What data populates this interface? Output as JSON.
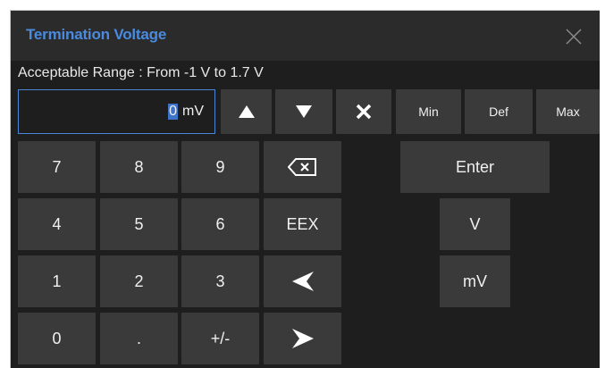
{
  "dialog": {
    "title": "Termination Voltage",
    "range_text": "Acceptable Range : From -1 V to 1.7 V"
  },
  "entry": {
    "value": "0",
    "unit": "mV"
  },
  "controls": {
    "up": "up-arrow-icon",
    "down": "down-arrow-icon",
    "clear": "clear-x-icon",
    "min_label": "Min",
    "def_label": "Def",
    "max_label": "Max"
  },
  "keypad": {
    "k7": "7",
    "k8": "8",
    "k9": "9",
    "k4": "4",
    "k5": "5",
    "k6": "6",
    "eex": "EEX",
    "k1": "1",
    "k2": "2",
    "k3": "3",
    "k0": "0",
    "dot": ".",
    "sign": "+/-"
  },
  "units": {
    "enter_label": "Enter",
    "v_label": "V",
    "mv_label": "mV"
  },
  "colors": {
    "title": "#4a8be0",
    "entry_border": "#4a86d4",
    "button": "#3a3a3a",
    "background": "#1e1e1e"
  }
}
